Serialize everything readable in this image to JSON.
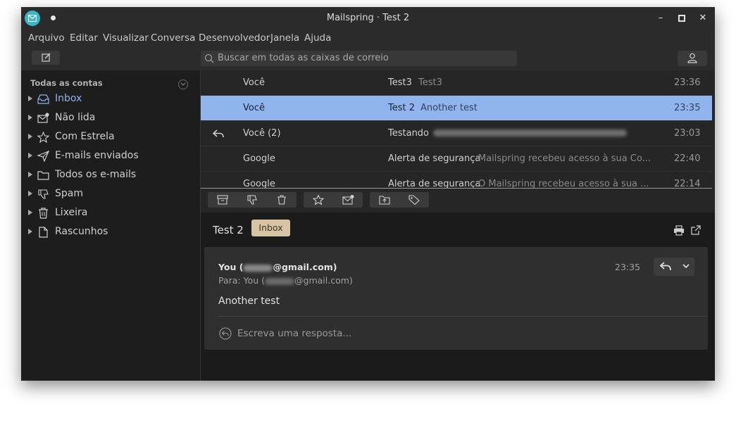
{
  "window": {
    "title": "Mailspring · Test 2",
    "controls": {
      "minimize": "–",
      "maximize": "▫",
      "close": "✕"
    }
  },
  "menu": [
    "Arquivo",
    "Editar",
    "Visualizar",
    "Conversa",
    "Desenvolvedor",
    "Janela",
    "Ajuda"
  ],
  "toolbar": {
    "search_placeholder": "Buscar em todas as caixas de correio"
  },
  "sidebar": {
    "header": "Todas as contas",
    "items": [
      {
        "label": "Inbox",
        "icon": "inbox-icon",
        "active": true
      },
      {
        "label": "Não lida",
        "icon": "unread-icon"
      },
      {
        "label": "Com Estrela",
        "icon": "star-icon"
      },
      {
        "label": "E-mails enviados",
        "icon": "sent-icon"
      },
      {
        "label": "Todos os e-mails",
        "icon": "folder-icon"
      },
      {
        "label": "Spam",
        "icon": "spam-icon"
      },
      {
        "label": "Lixeira",
        "icon": "trash-icon"
      },
      {
        "label": "Rascunhos",
        "icon": "drafts-icon"
      }
    ]
  },
  "threads": [
    {
      "sender": "Você",
      "subject": "Test3",
      "snippet": "Test3",
      "time": "23:36"
    },
    {
      "sender": "Você",
      "subject": "Test 2",
      "snippet": "Another test",
      "time": "23:35",
      "selected": true
    },
    {
      "sender": "Você (2)",
      "subject": "Testando",
      "snippet": "",
      "time": "23:03",
      "replied": true
    },
    {
      "sender": "Google",
      "subject": "Alerta de segurança",
      "snippet": "Mailspring recebeu acesso à sua Co...",
      "time": "22:40"
    },
    {
      "sender": "Google",
      "subject": "Alerta de segurança",
      "snippet": "O Mailspring recebeu acesso à sua ...",
      "time": "22:14"
    }
  ],
  "reader": {
    "subject": "Test 2",
    "label": "Inbox",
    "message": {
      "from_prefix": "You (",
      "from_suffix": "@gmail.com)",
      "to_prefix": "Para: You (",
      "to_suffix": "@gmail.com)",
      "time": "23:35",
      "body": "Another test",
      "reply_placeholder": "Escreva uma resposta..."
    }
  },
  "colors": {
    "accent_selected_row": "#8fb4ee",
    "inbox_active": "#8fb4ee",
    "label_tag": "#d7c4a5",
    "app_icon": "#38b7c8"
  }
}
